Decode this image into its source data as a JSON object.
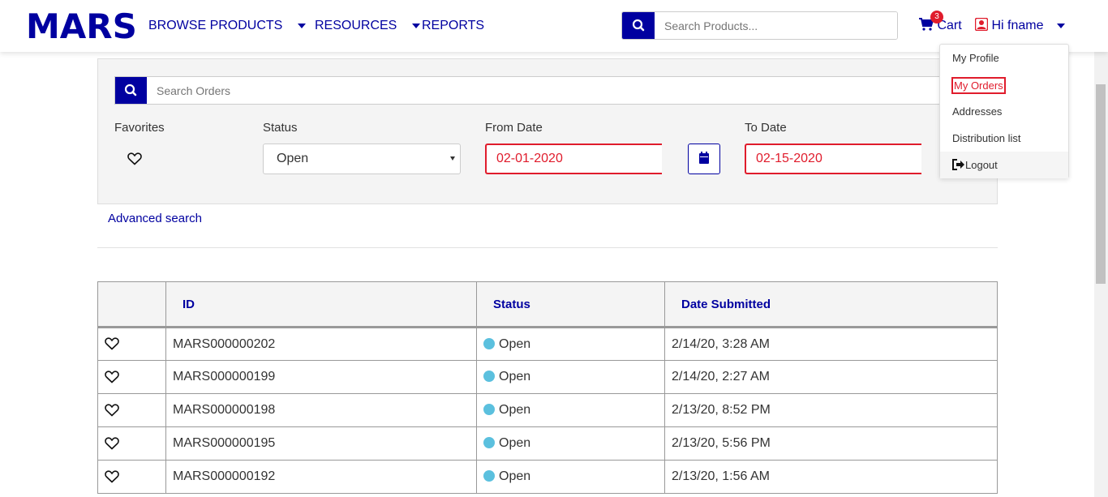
{
  "header": {
    "logo": "MARS",
    "nav": [
      {
        "label": "BROWSE PRODUCTS",
        "has_caret": true
      },
      {
        "label": "RESOURCES",
        "has_caret": true
      },
      {
        "label": "REPORTS",
        "has_caret": false
      }
    ],
    "search_placeholder": "Search Products...",
    "cart_label": "Cart",
    "cart_count": "3",
    "user_greeting": "Hi fname"
  },
  "user_menu": {
    "items": [
      "My Profile",
      "My Orders",
      "Addresses",
      "Distribution list"
    ],
    "active_item": "My Orders",
    "logout_label": "Logout"
  },
  "filters": {
    "search_placeholder": "Search Orders",
    "favorites_label": "Favorites",
    "status_label": "Status",
    "status_value": "Open",
    "from_date_label": "From Date",
    "from_date_value": "02-01-2020",
    "to_date_label": "To Date",
    "to_date_value": "02-15-2020",
    "advanced_search": "Advanced search"
  },
  "table": {
    "headers": [
      "ID",
      "Status",
      "Date Submitted"
    ],
    "rows": [
      {
        "id": "MARS000000202",
        "status": "Open",
        "date": "2/14/20, 3:28 AM"
      },
      {
        "id": "MARS000000199",
        "status": "Open",
        "date": "2/14/20, 2:27 AM"
      },
      {
        "id": "MARS000000198",
        "status": "Open",
        "date": "2/13/20, 8:52 PM"
      },
      {
        "id": "MARS000000195",
        "status": "Open",
        "date": "2/13/20, 5:56 PM"
      },
      {
        "id": "MARS000000192",
        "status": "Open",
        "date": "2/13/20, 1:56 AM"
      }
    ]
  },
  "colors": {
    "brand": "#0000a0",
    "alert": "#e01c2c",
    "status_open": "#5bc0de"
  }
}
